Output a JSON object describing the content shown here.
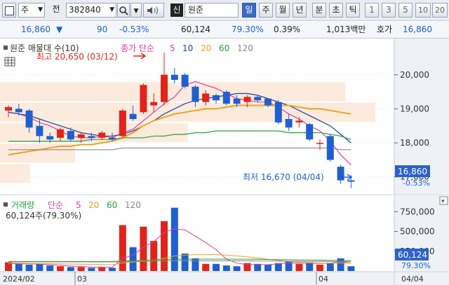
{
  "toolbar": {
    "menu_icon": "panel-icon",
    "stock_type": "주",
    "period_label": "전",
    "code": "382840",
    "company": "원준",
    "credit_badge": "신",
    "periods": [
      "일",
      "주",
      "월",
      "년",
      "분",
      "초",
      "틱"
    ],
    "active_period": "일",
    "intervals": [
      "1",
      "3",
      "5",
      "10",
      "20"
    ]
  },
  "info": {
    "price": "16,860",
    "change": "90",
    "change_pct": "-0.53%",
    "volume": "60,124",
    "volume_ratio": "79.30%",
    "turnover": "0.39%",
    "amount": "1,013백만",
    "quote_label": "호가",
    "quote_price": "16,860"
  },
  "colors": {
    "up": "#e2231a",
    "down": "#1f5fd1",
    "ma5": "#e03aa0",
    "ma10": "#1f3fa8",
    "ma20": "#f0a020",
    "ma60": "#23a03a",
    "ma120": "#888888"
  },
  "legend": {
    "title": "원준 매물대 수(10)",
    "line_type": "종가 단순",
    "periods": [
      "5",
      "10",
      "20",
      "60",
      "120"
    ]
  },
  "annotations": {
    "high": "최고 20,650 (03/12)",
    "low": "최저 16,670 (04/04)"
  },
  "price_axis": {
    "ticks": [
      "20,000",
      "19,000",
      "18,000",
      "17,000"
    ],
    "current": "16,860",
    "current_pct": "-0.53%"
  },
  "volume_legend": {
    "title": "거래량",
    "line_type": "단순",
    "periods": [
      "5",
      "20",
      "60",
      "120"
    ],
    "value": "60,124주(79.30%)"
  },
  "volume_axis": {
    "ticks": [
      "750,000",
      "500,000",
      "250,000"
    ],
    "current": "60,124",
    "current_pct": "79.30%"
  },
  "date_axis": {
    "labels": [
      "2024/02",
      "03",
      "04"
    ],
    "right_label": "04/04"
  },
  "chart_data": {
    "type": "candlestick",
    "title": "원준 (382840) 일봉",
    "price_range": [
      16500,
      20900
    ],
    "volume_range": [
      0,
      850000
    ],
    "candles": [
      {
        "o": 18950,
        "h": 19100,
        "l": 18750,
        "c": 19050
      },
      {
        "o": 19000,
        "h": 19150,
        "l": 18800,
        "c": 18900
      },
      {
        "o": 18950,
        "h": 19000,
        "l": 18300,
        "c": 18450
      },
      {
        "o": 18500,
        "h": 18700,
        "l": 18000,
        "c": 18200
      },
      {
        "o": 18200,
        "h": 18300,
        "l": 18000,
        "c": 18100
      },
      {
        "o": 18150,
        "h": 18450,
        "l": 18050,
        "c": 18400
      },
      {
        "o": 18350,
        "h": 18450,
        "l": 18050,
        "c": 18100
      },
      {
        "o": 18150,
        "h": 18300,
        "l": 18000,
        "c": 18250
      },
      {
        "o": 18200,
        "h": 18300,
        "l": 18050,
        "c": 18150
      },
      {
        "o": 18150,
        "h": 18350,
        "l": 18100,
        "c": 18300
      },
      {
        "o": 18150,
        "h": 18300,
        "l": 18050,
        "c": 18100
      },
      {
        "o": 18200,
        "h": 19000,
        "l": 18150,
        "c": 18950
      },
      {
        "o": 18850,
        "h": 19100,
        "l": 18650,
        "c": 18700
      },
      {
        "o": 18900,
        "h": 19750,
        "l": 18850,
        "c": 19700
      },
      {
        "o": 19100,
        "h": 19450,
        "l": 18900,
        "c": 19200
      },
      {
        "o": 19200,
        "h": 20650,
        "l": 19100,
        "c": 20000
      },
      {
        "o": 20000,
        "h": 20200,
        "l": 19750,
        "c": 19850
      },
      {
        "o": 20000,
        "h": 20050,
        "l": 19600,
        "c": 19650
      },
      {
        "o": 19650,
        "h": 19700,
        "l": 19050,
        "c": 19200
      },
      {
        "o": 19200,
        "h": 19550,
        "l": 19100,
        "c": 19450
      },
      {
        "o": 19400,
        "h": 19450,
        "l": 19150,
        "c": 19250
      },
      {
        "o": 19500,
        "h": 19550,
        "l": 19100,
        "c": 19150
      },
      {
        "o": 19300,
        "h": 19400,
        "l": 19050,
        "c": 19150
      },
      {
        "o": 19200,
        "h": 19400,
        "l": 19050,
        "c": 19350
      },
      {
        "o": 19350,
        "h": 19400,
        "l": 19200,
        "c": 19250
      },
      {
        "o": 19300,
        "h": 19300,
        "l": 19050,
        "c": 19100
      },
      {
        "o": 19200,
        "h": 19250,
        "l": 18550,
        "c": 18600
      },
      {
        "o": 18700,
        "h": 18850,
        "l": 18350,
        "c": 18450
      },
      {
        "o": 18600,
        "h": 18750,
        "l": 18450,
        "c": 18650
      },
      {
        "o": 18550,
        "h": 18600,
        "l": 18050,
        "c": 18100
      },
      {
        "o": 18000,
        "h": 18100,
        "l": 17800,
        "c": 18000
      },
      {
        "o": 18200,
        "h": 18250,
        "l": 17450,
        "c": 17500
      },
      {
        "o": 17300,
        "h": 17350,
        "l": 16800,
        "c": 16900
      },
      {
        "o": 16900,
        "h": 17050,
        "l": 16670,
        "c": 16860
      }
    ],
    "volumes": [
      110000,
      95000,
      80000,
      90000,
      70000,
      60000,
      50000,
      50000,
      40000,
      45000,
      40000,
      580000,
      300000,
      560000,
      380000,
      630000,
      800000,
      220000,
      160000,
      90000,
      90000,
      70000,
      60000,
      100000,
      90000,
      80000,
      100000,
      120000,
      90000,
      110000,
      80000,
      100000,
      160000,
      60124
    ],
    "ma_series": [
      {
        "name": "5",
        "color": "#e03aa0",
        "values": [
          18900,
          18850,
          18750,
          18600,
          18500,
          18350,
          18200,
          18150,
          18150,
          18200,
          18150,
          18300,
          18400,
          18650,
          18900,
          19150,
          19350,
          19700,
          19800,
          19700,
          19600,
          19450,
          19300,
          19250,
          19200,
          19200,
          19050,
          18850,
          18700,
          18500,
          18350,
          18050,
          17650,
          17350
        ]
      },
      {
        "name": "10",
        "color": "#1f3fa8",
        "values": [
          18900,
          18850,
          18800,
          18700,
          18600,
          18500,
          18400,
          18300,
          18250,
          18200,
          18200,
          18250,
          18350,
          18500,
          18650,
          18850,
          19000,
          19150,
          19250,
          19300,
          19350,
          19400,
          19450,
          19450,
          19400,
          19300,
          19200,
          19100,
          18950,
          18800,
          18650,
          18500,
          18250,
          18000
        ]
      },
      {
        "name": "20",
        "color": "#f0a020",
        "values": [
          17650,
          17700,
          17750,
          17800,
          17850,
          17900,
          17900,
          17950,
          17950,
          18000,
          18050,
          18150,
          18300,
          18500,
          18650,
          18750,
          18850,
          18900,
          18950,
          19000,
          19000,
          19050,
          19100,
          19100,
          19100,
          19100,
          19100,
          19100,
          19050,
          19000,
          19000,
          18950,
          18900,
          18850
        ]
      },
      {
        "name": "60",
        "color": "#23a03a",
        "values": [
          18050,
          18050,
          18050,
          18050,
          18050,
          18050,
          18050,
          18050,
          18100,
          18100,
          18100,
          18150,
          18150,
          18150,
          18200,
          18200,
          18250,
          18250,
          18300,
          18300,
          18350,
          18350,
          18350,
          18350,
          18350,
          18350,
          18350,
          18300,
          18300,
          18300,
          18300,
          18250,
          18200,
          18100
        ]
      },
      {
        "name": "120",
        "color": "#888888",
        "values": [
          17800,
          17800,
          17800,
          17800,
          17800,
          17800,
          17800,
          17800,
          17800,
          17800,
          17800,
          17850,
          17850,
          17850,
          17850,
          17850,
          17850,
          17850,
          17850,
          17850,
          17850,
          17850,
          17850,
          17850,
          17850,
          17850,
          17850,
          17850,
          17850,
          17850,
          17850,
          17850,
          17800,
          17800
        ]
      }
    ],
    "vol_ma_series": [
      {
        "name": "5",
        "color": "#e03aa0",
        "values": [
          95000,
          90000,
          90000,
          88000,
          80000,
          72000,
          62000,
          56000,
          50000,
          48000,
          45000,
          160000,
          200000,
          300000,
          370000,
          490000,
          530000,
          520000,
          440000,
          360000,
          270000,
          150000,
          100000,
          80000,
          80000,
          80000,
          90000,
          100000,
          100000,
          100000,
          95000,
          100000,
          115000,
          100000
        ]
      },
      {
        "name": "20",
        "color": "#f0a020",
        "values": [
          100000,
          98000,
          96000,
          94000,
          92000,
          90000,
          88000,
          86000,
          84000,
          82000,
          80000,
          100000,
          110000,
          130000,
          140000,
          160000,
          190000,
          200000,
          205000,
          205000,
          205000,
          200000,
          190000,
          180000,
          165000,
          150000,
          135000,
          120000,
          110000,
          105000,
          100000,
          100000,
          100000,
          100000
        ]
      },
      {
        "name": "60",
        "color": "#23a03a",
        "values": [
          120000,
          120000,
          120000,
          120000,
          120000,
          120000,
          120000,
          120000,
          120000,
          120000,
          120000,
          125000,
          130000,
          135000,
          140000,
          145000,
          150000,
          150000,
          150000,
          150000,
          150000,
          150000,
          150000,
          150000,
          148000,
          146000,
          144000,
          142000,
          140000,
          138000,
          136000,
          134000,
          132000,
          130000
        ]
      },
      {
        "name": "120",
        "color": "#888888",
        "values": [
          115000,
          115000,
          115000,
          115000,
          115000,
          115000,
          115000,
          115000,
          115000,
          115000,
          115000,
          118000,
          120000,
          122000,
          124000,
          126000,
          128000,
          128000,
          128000,
          128000,
          128000,
          128000,
          128000,
          128000,
          127000,
          126000,
          125000,
          124000,
          123000,
          122000,
          121000,
          120000,
          120000,
          120000
        ]
      }
    ],
    "volume_profile": [
      {
        "from": 19200,
        "to": 19800,
        "weight": 0.92
      },
      {
        "from": 18600,
        "to": 19200,
        "weight": 1.0
      },
      {
        "from": 18000,
        "to": 18600,
        "weight": 0.5
      },
      {
        "from": 17400,
        "to": 18000,
        "weight": 0.2
      },
      {
        "from": 16800,
        "to": 17400,
        "weight": 0.08
      }
    ]
  }
}
